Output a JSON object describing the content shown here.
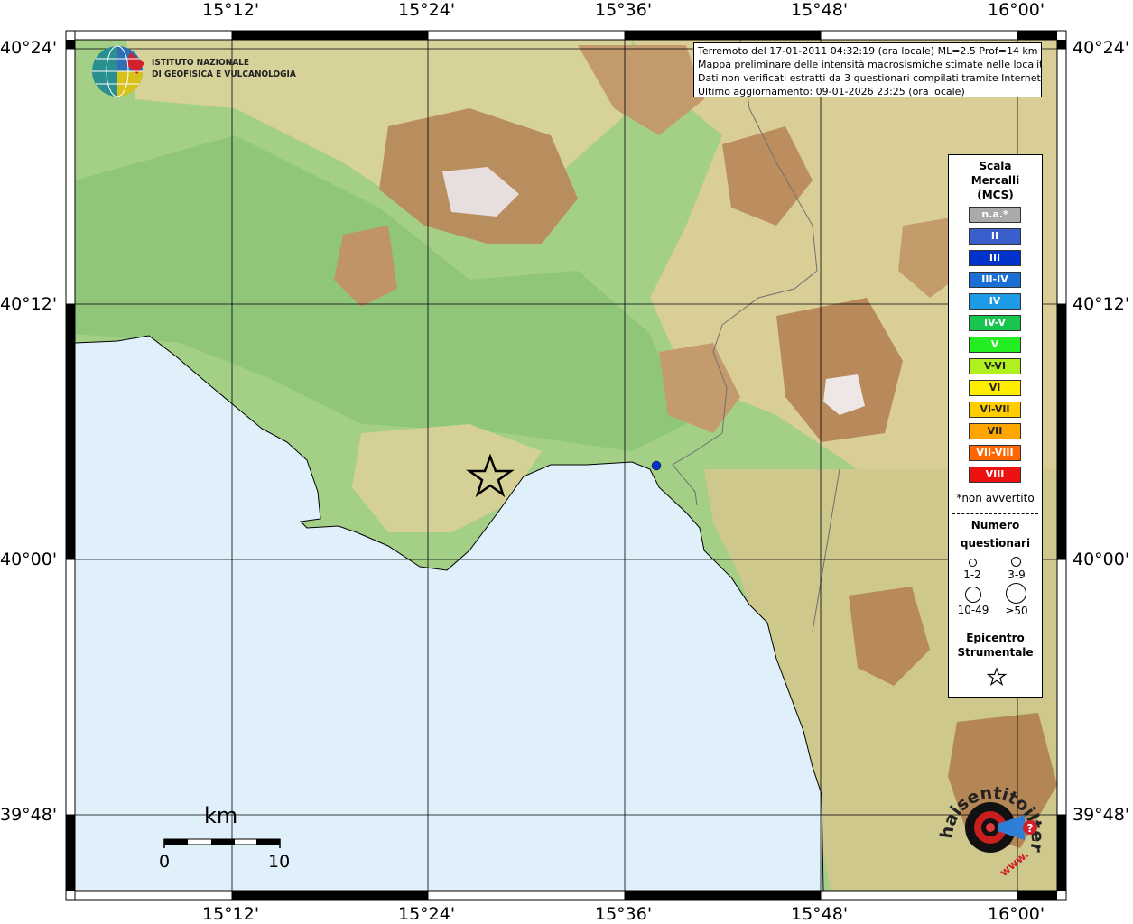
{
  "map": {
    "lon_ticks": [
      "15°12'",
      "15°24'",
      "15°36'",
      "15°48'",
      "16°00'"
    ],
    "lat_ticks": [
      "40°24'",
      "40°12'",
      "40°00'",
      "39°48'"
    ],
    "extent": {
      "lon_min": 15.0,
      "lon_max": 16.0,
      "lat_min": 39.7333,
      "lat_max": 40.4
    },
    "epicentre_symbol": "star-icon",
    "colors": {
      "sea": "#dff0fb",
      "lowland": "#8fc67a",
      "hill": "#d9cf96",
      "mountain": "#b8895a",
      "peak": "#e7dede"
    }
  },
  "info": {
    "line1": "Terremoto del 17-01-2011 04:32:19 (ora locale) ML=2.5 Prof=14 km",
    "line2": "Mappa preliminare delle intensità macrosismiche stimate nelle località",
    "line3": "Dati non verificati estratti da 3 questionari compilati tramite Internet.",
    "line4": "Ultimo aggiornamento: 09-01-2026 23:25 (ora locale)"
  },
  "logo": {
    "line1": "ISTITUTO NAZIONALE",
    "line2": "DI GEOFISICA E VULCANOLOGIA",
    "hst_text": "haisentitoilterremoto.it",
    "hst_url": "www.",
    "hst_q": "?"
  },
  "legend": {
    "title": "Scala\nMercalli\n(MCS)",
    "title_lines": [
      "Scala",
      "Mercalli",
      "(MCS)"
    ],
    "classes": [
      {
        "label": "n.a.*",
        "color": "#aaaaaa"
      },
      {
        "label": "II",
        "color": "#3a5fcd"
      },
      {
        "label": "III",
        "color": "#0033cc"
      },
      {
        "label": "III-IV",
        "color": "#1a6fd4"
      },
      {
        "label": "IV",
        "color": "#1e9be6"
      },
      {
        "label": "IV-V",
        "color": "#18c54f"
      },
      {
        "label": "V",
        "color": "#22ee22"
      },
      {
        "label": "V-VI",
        "color": "#b0f01e"
      },
      {
        "label": "VI",
        "color": "#ffee00"
      },
      {
        "label": "VI-VII",
        "color": "#ffcc00"
      },
      {
        "label": "VII",
        "color": "#ffa500"
      },
      {
        "label": "VII-VIII",
        "color": "#ff6600"
      },
      {
        "label": "VIII",
        "color": "#ee1111"
      }
    ],
    "note": "*non avvertito",
    "numero": "Numero",
    "questionari": "questionari",
    "q_labels": [
      "1-2",
      "3-9",
      "10-49",
      "≥50"
    ],
    "epicentro": "Epicentro",
    "strumentale": "Strumentale"
  },
  "scale": {
    "unit": "km",
    "min": "0",
    "max": "10"
  }
}
